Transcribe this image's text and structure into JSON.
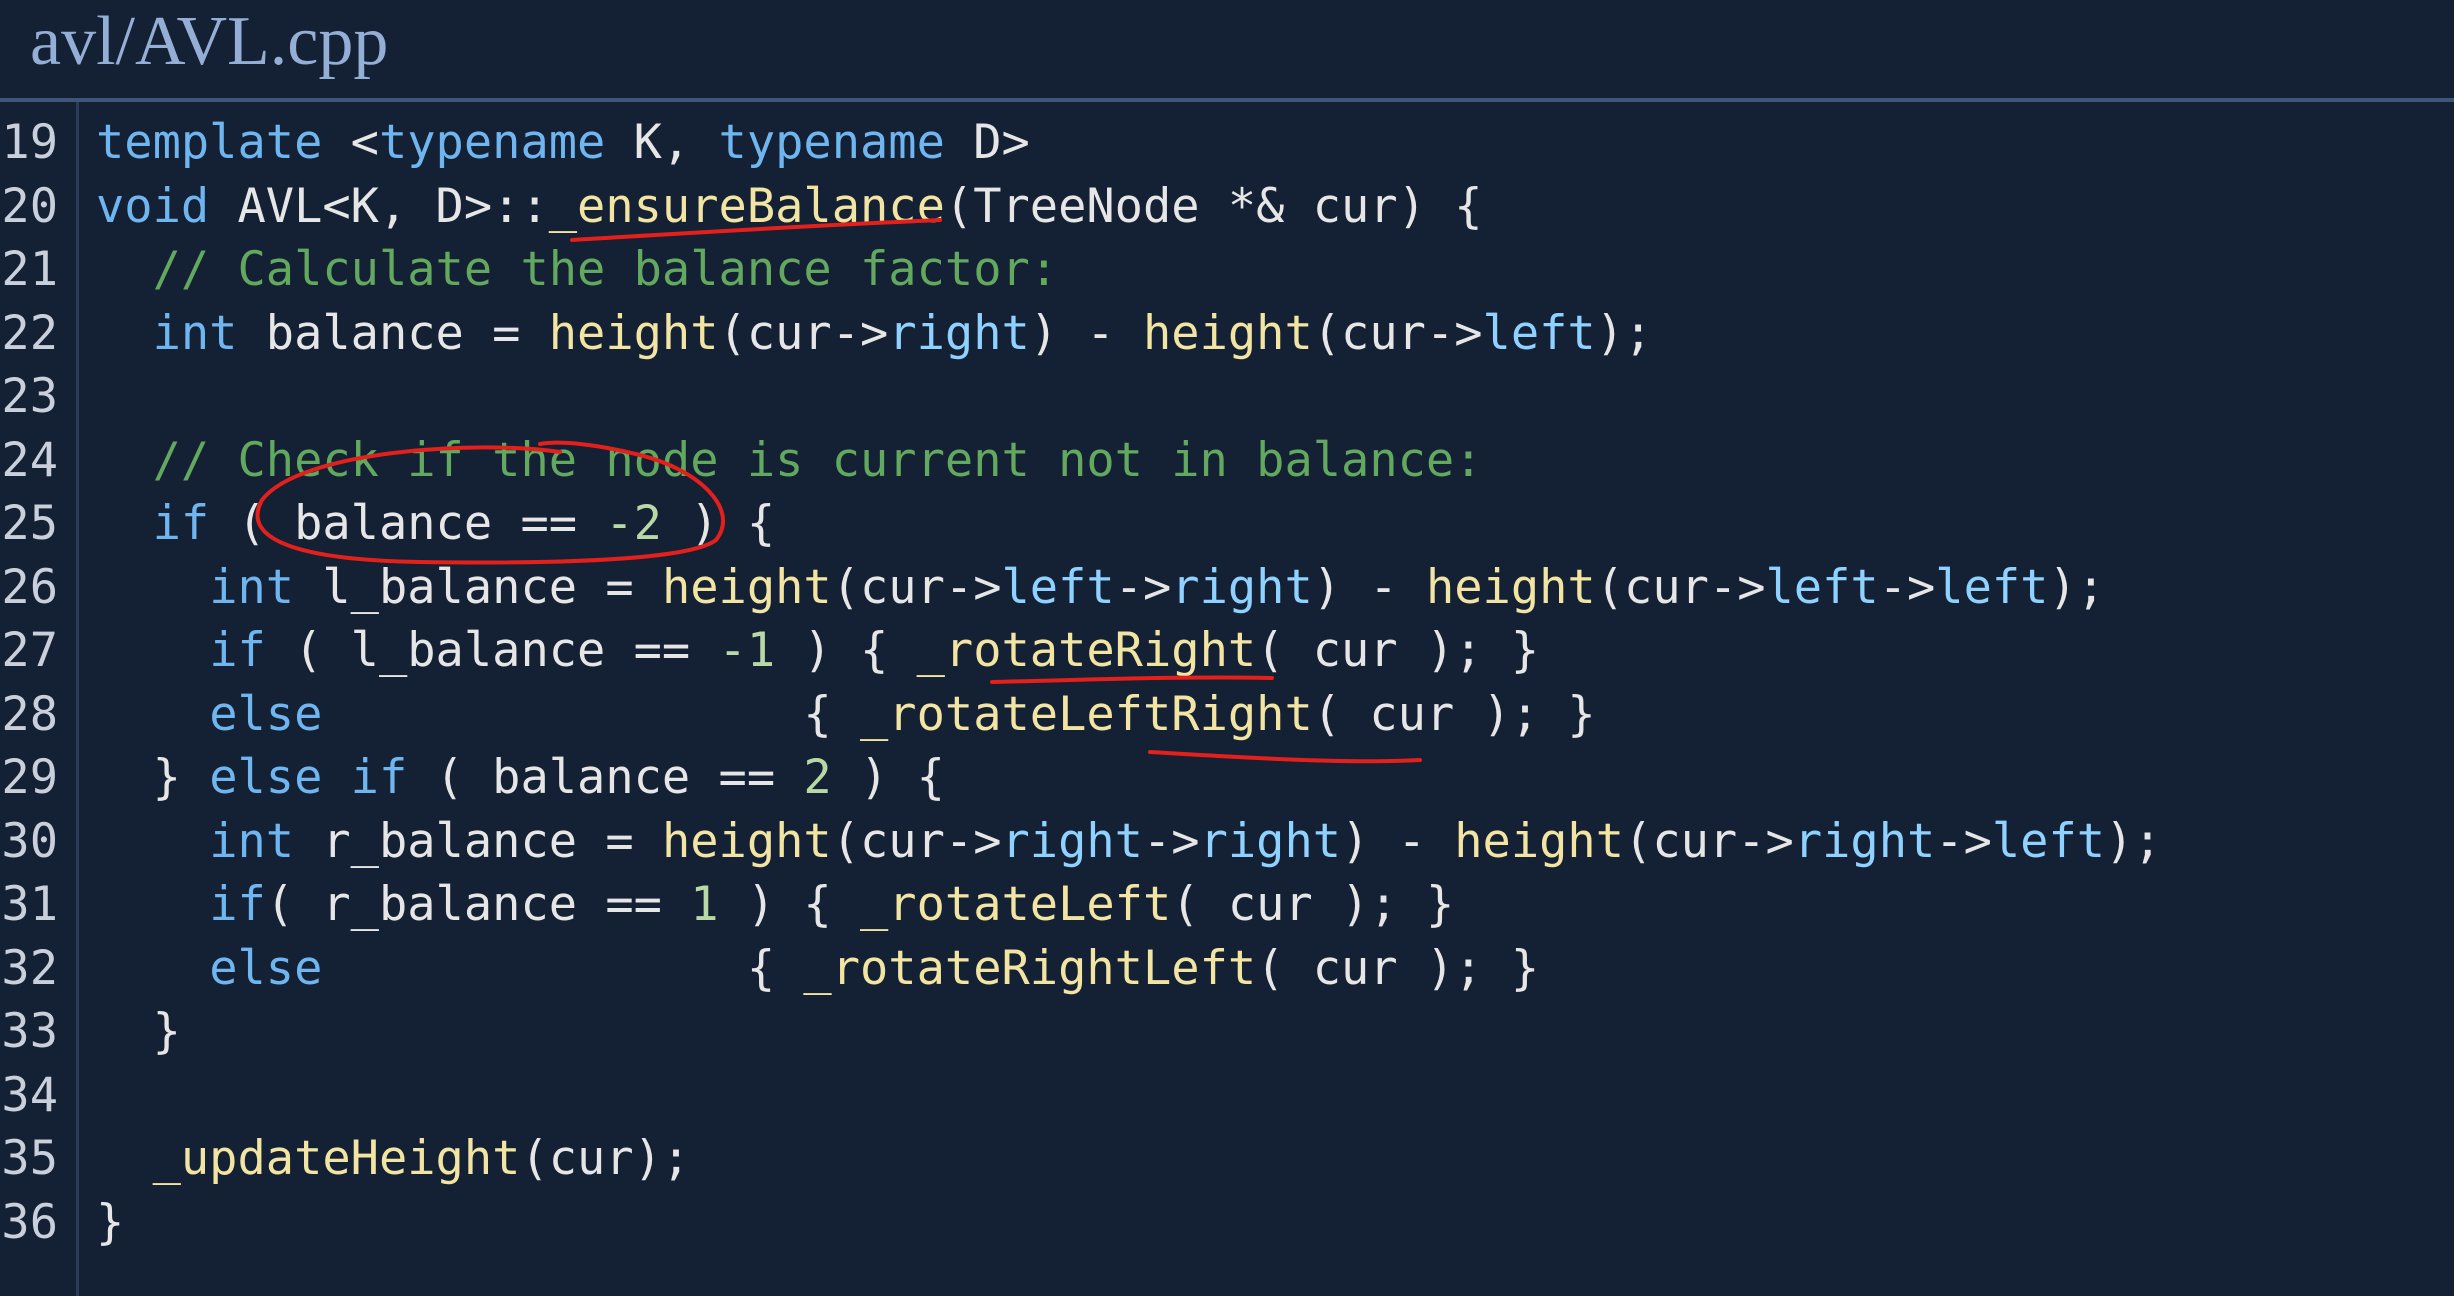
{
  "title": "avl/AVL.cpp",
  "lines": [
    {
      "n": "19",
      "tokens": [
        [
          "kw",
          "template"
        ],
        [
          "tx",
          " <"
        ],
        [
          "kw",
          "typename"
        ],
        [
          "tx",
          " K, "
        ],
        [
          "kw",
          "typename"
        ],
        [
          "tx",
          " D>"
        ]
      ]
    },
    {
      "n": "20",
      "tokens": [
        [
          "kw",
          "void"
        ],
        [
          "tx",
          " AVL<K, D>::"
        ],
        [
          "fn",
          "_ensureBalance"
        ],
        [
          "tx",
          "(TreeNode *& cur) {"
        ]
      ]
    },
    {
      "n": "21",
      "tokens": [
        [
          "tx",
          "  "
        ],
        [
          "cm",
          "// Calculate the balance factor:"
        ]
      ]
    },
    {
      "n": "22",
      "tokens": [
        [
          "tx",
          "  "
        ],
        [
          "kw",
          "int"
        ],
        [
          "tx",
          " balance = "
        ],
        [
          "fn",
          "height"
        ],
        [
          "tx",
          "(cur->"
        ],
        [
          "prop",
          "right"
        ],
        [
          "tx",
          ") - "
        ],
        [
          "fn",
          "height"
        ],
        [
          "tx",
          "(cur->"
        ],
        [
          "prop",
          "left"
        ],
        [
          "tx",
          ");"
        ]
      ]
    },
    {
      "n": "23",
      "tokens": []
    },
    {
      "n": "24",
      "tokens": [
        [
          "tx",
          "  "
        ],
        [
          "cm",
          "// Check if the node is current not in balance:"
        ]
      ]
    },
    {
      "n": "25",
      "tokens": [
        [
          "tx",
          "  "
        ],
        [
          "kw",
          "if"
        ],
        [
          "tx",
          " ( balance == "
        ],
        [
          "num",
          "-2"
        ],
        [
          "tx",
          " ) {"
        ]
      ]
    },
    {
      "n": "26",
      "tokens": [
        [
          "tx",
          "    "
        ],
        [
          "kw",
          "int"
        ],
        [
          "tx",
          " l_balance = "
        ],
        [
          "fn",
          "height"
        ],
        [
          "tx",
          "(cur->"
        ],
        [
          "prop",
          "left"
        ],
        [
          "tx",
          "->"
        ],
        [
          "prop",
          "right"
        ],
        [
          "tx",
          ") - "
        ],
        [
          "fn",
          "height"
        ],
        [
          "tx",
          "(cur->"
        ],
        [
          "prop",
          "left"
        ],
        [
          "tx",
          "->"
        ],
        [
          "prop",
          "left"
        ],
        [
          "tx",
          ");"
        ]
      ]
    },
    {
      "n": "27",
      "tokens": [
        [
          "tx",
          "    "
        ],
        [
          "kw",
          "if"
        ],
        [
          "tx",
          " ( l_balance == "
        ],
        [
          "num",
          "-1"
        ],
        [
          "tx",
          " ) { "
        ],
        [
          "fn",
          "_rotateRight"
        ],
        [
          "tx",
          "( cur ); }"
        ]
      ]
    },
    {
      "n": "28",
      "tokens": [
        [
          "tx",
          "    "
        ],
        [
          "kw",
          "else"
        ],
        [
          "tx",
          "                 { "
        ],
        [
          "fn",
          "_rotateLeftRight"
        ],
        [
          "tx",
          "( cur ); }"
        ]
      ]
    },
    {
      "n": "29",
      "tokens": [
        [
          "tx",
          "  } "
        ],
        [
          "kw",
          "else if"
        ],
        [
          "tx",
          " ( balance == "
        ],
        [
          "num",
          "2"
        ],
        [
          "tx",
          " ) {"
        ]
      ]
    },
    {
      "n": "30",
      "tokens": [
        [
          "tx",
          "    "
        ],
        [
          "kw",
          "int"
        ],
        [
          "tx",
          " r_balance = "
        ],
        [
          "fn",
          "height"
        ],
        [
          "tx",
          "(cur->"
        ],
        [
          "prop",
          "right"
        ],
        [
          "tx",
          "->"
        ],
        [
          "prop",
          "right"
        ],
        [
          "tx",
          ") - "
        ],
        [
          "fn",
          "height"
        ],
        [
          "tx",
          "(cur->"
        ],
        [
          "prop",
          "right"
        ],
        [
          "tx",
          "->"
        ],
        [
          "prop",
          "left"
        ],
        [
          "tx",
          ");"
        ]
      ]
    },
    {
      "n": "31",
      "tokens": [
        [
          "tx",
          "    "
        ],
        [
          "kw",
          "if"
        ],
        [
          "tx",
          "( r_balance == "
        ],
        [
          "num",
          "1"
        ],
        [
          "tx",
          " ) { "
        ],
        [
          "fn",
          "_rotateLeft"
        ],
        [
          "tx",
          "( cur ); }"
        ]
      ]
    },
    {
      "n": "32",
      "tokens": [
        [
          "tx",
          "    "
        ],
        [
          "kw",
          "else"
        ],
        [
          "tx",
          "               { "
        ],
        [
          "fn",
          "_rotateRightLeft"
        ],
        [
          "tx",
          "( cur ); }"
        ]
      ]
    },
    {
      "n": "33",
      "tokens": [
        [
          "tx",
          "  }"
        ]
      ]
    },
    {
      "n": "34",
      "tokens": []
    },
    {
      "n": "35",
      "tokens": [
        [
          "tx",
          "  "
        ],
        [
          "fn",
          "_updateHeight"
        ],
        [
          "tx",
          "(cur);"
        ]
      ]
    },
    {
      "n": "36",
      "tokens": [
        [
          "tx",
          "}"
        ]
      ]
    }
  ],
  "colors": {
    "background": "#142033",
    "keyword": "#6fb6f0",
    "function": "#f2e4a2",
    "property": "#8fd1ff",
    "comment": "#63a85f",
    "number": "#b9d8a6",
    "annotation": "#e3201b"
  }
}
